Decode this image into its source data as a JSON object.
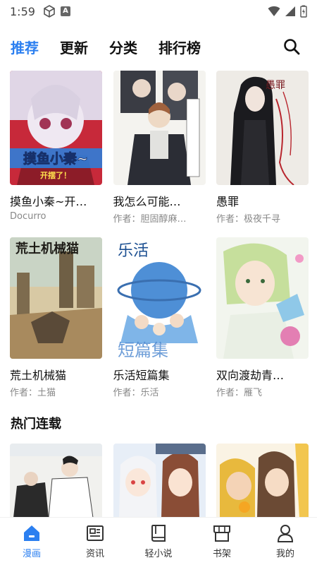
{
  "status": {
    "time": "1:59",
    "a_icon": "A"
  },
  "tabs": [
    "推荐",
    "更新",
    "分类",
    "排行榜"
  ],
  "row1": [
    {
      "title": "摸鱼小秦~开…",
      "sub": "Docurro"
    },
    {
      "title": "我怎么可能…",
      "sub": "作者：胆固醇麻…"
    },
    {
      "title": "愚罪",
      "sub": "作者：极夜千寻"
    }
  ],
  "row2": [
    {
      "title": "荒土机械猫",
      "sub": "作者：土猫"
    },
    {
      "title": "乐活短篇集",
      "sub": "作者：乐活"
    },
    {
      "title": "双向渡劫青…",
      "sub": "作者：雁飞"
    }
  ],
  "section": "热门连载",
  "cover_text": {
    "moyu": "摸鱼小秦~",
    "moyu_small": "开摆了！",
    "huangtu": "荒土机械猫",
    "lehuo_top": "乐活",
    "lehuo_bottom": "短篇集",
    "yuzui": "愚罪"
  },
  "bottom_nav": [
    {
      "label": "漫画",
      "icon": "home-icon"
    },
    {
      "label": "资讯",
      "icon": "news-icon"
    },
    {
      "label": "轻小说",
      "icon": "book-icon"
    },
    {
      "label": "书架",
      "icon": "shelf-icon"
    },
    {
      "label": "我的",
      "icon": "user-icon"
    }
  ],
  "colors": {
    "accent": "#2b7ff0"
  }
}
